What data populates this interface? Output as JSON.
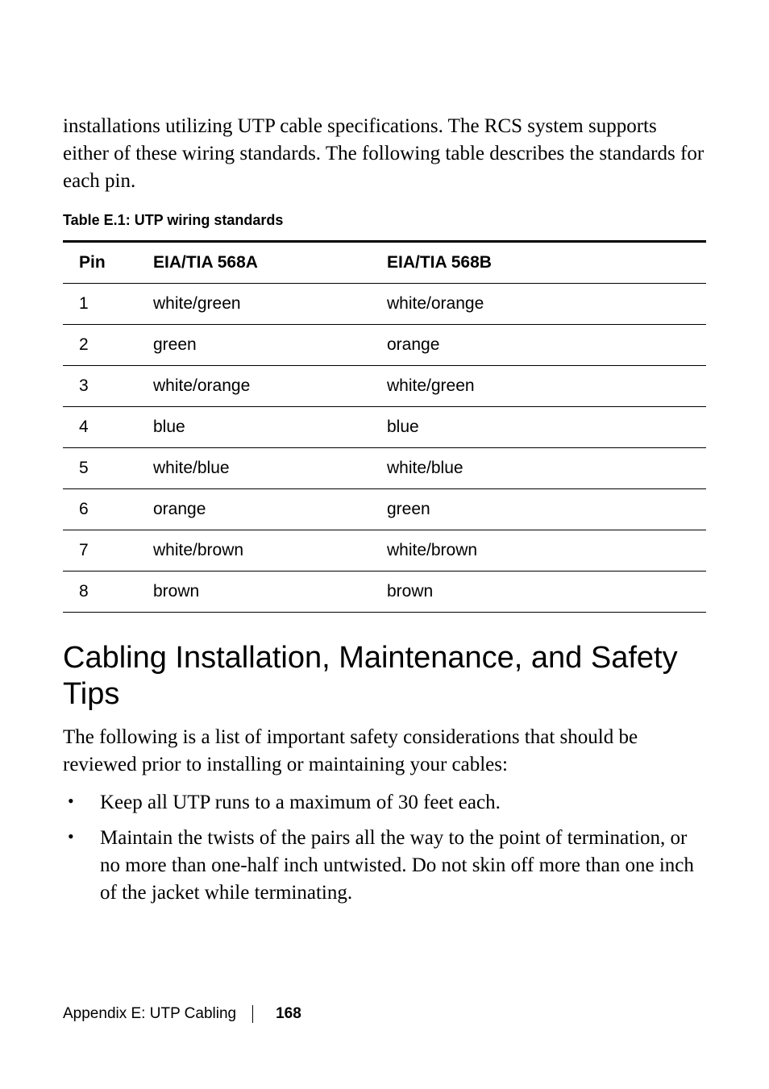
{
  "intro": "installations utilizing UTP cable specifications. The RCS system supports either of these wiring standards. The following table describes the standards for each pin.",
  "table_caption": "Table E.1: UTP wiring standards",
  "table": {
    "headers": {
      "pin": "Pin",
      "a": "EIA/TIA 568A",
      "b": "EIA/TIA 568B"
    },
    "rows": [
      {
        "pin": "1",
        "a": "white/green",
        "b": "white/orange"
      },
      {
        "pin": "2",
        "a": "green",
        "b": "orange"
      },
      {
        "pin": "3",
        "a": "white/orange",
        "b": "white/green"
      },
      {
        "pin": "4",
        "a": "blue",
        "b": "blue"
      },
      {
        "pin": "5",
        "a": "white/blue",
        "b": "white/blue"
      },
      {
        "pin": "6",
        "a": "orange",
        "b": "green"
      },
      {
        "pin": "7",
        "a": "white/brown",
        "b": "white/brown"
      },
      {
        "pin": "8",
        "a": "brown",
        "b": "brown"
      }
    ]
  },
  "section_heading": "Cabling Installation, Maintenance, and Safety Tips",
  "section_para": "The following is a list of important safety considerations that should be reviewed prior to installing or maintaining your cables:",
  "tips": [
    "Keep all UTP runs to a maximum of 30 feet each.",
    "Maintain the twists of the pairs all the way to the point of termination, or no more than one-half inch untwisted. Do not skin off more than one inch of the jacket while terminating."
  ],
  "footer": {
    "section": "Appendix E: UTP Cabling",
    "page": "168"
  }
}
